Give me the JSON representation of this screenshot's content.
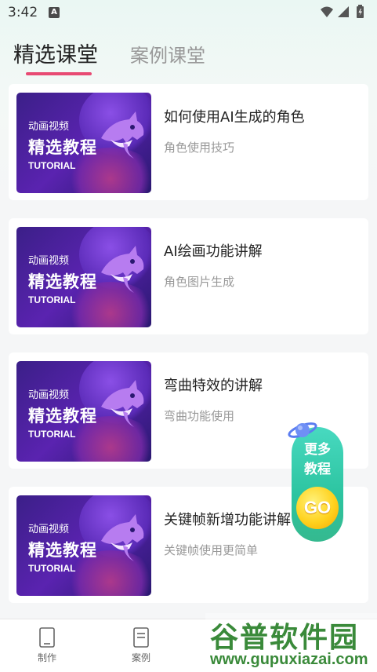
{
  "status_bar": {
    "time": "3:42",
    "notification_letter": "A"
  },
  "tabs": [
    {
      "label": "精选课堂",
      "active": true
    },
    {
      "label": "案例课堂",
      "active": false
    }
  ],
  "thumbnail": {
    "sub": "动画视频",
    "main": "精选教程",
    "en": "TUTORIAL"
  },
  "courses": [
    {
      "title": "如何使用AI生成的角色",
      "subtitle": "角色使用技巧"
    },
    {
      "title": "AI绘画功能讲解",
      "subtitle": "角色图片生成"
    },
    {
      "title": "弯曲特效的讲解",
      "subtitle": "弯曲功能使用"
    },
    {
      "title": "关键帧新增功能讲解",
      "subtitle": "关键帧使用更简单"
    }
  ],
  "float_button": {
    "line1": "更多",
    "line2": "教程",
    "go": "GO"
  },
  "bottom_nav": [
    {
      "label": "制作",
      "icon": "phone-icon"
    },
    {
      "label": "案例",
      "icon": "document-icon"
    }
  ],
  "watermark": {
    "top": "谷普软件园",
    "bottom": "www.gupuxiazai.com"
  },
  "colors": {
    "accent": "#e84a73",
    "float_green": "#2cc4a0",
    "go_yellow": "#ffd21f"
  }
}
